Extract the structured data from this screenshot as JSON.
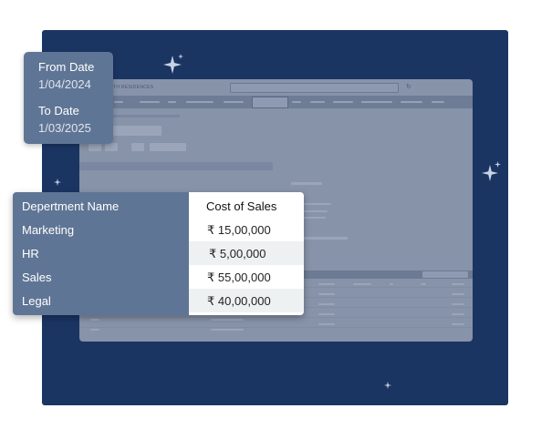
{
  "date_filter": {
    "from_label": "From Date",
    "from_value": "1/04/2024",
    "to_label": "To Date",
    "to_value": "1/03/2025"
  },
  "table": {
    "headers": [
      "Depertment Name",
      "Cost of Sales"
    ],
    "rows": [
      {
        "department": "Marketing",
        "cost": "₹ 15,00,000"
      },
      {
        "department": "HR",
        "cost": "₹ 5,00,000"
      },
      {
        "department": "Sales",
        "cost": "₹ 55,00,000"
      },
      {
        "department": "Legal",
        "cost": "₹ 40,00,000"
      }
    ]
  },
  "background_app": {
    "title": "...NTH RESIDENCES"
  },
  "colors": {
    "navy_panel": "#1b3563",
    "card_slate": "#5f7595",
    "app_window": "#8793a9"
  },
  "icons": [
    "sparkle-icon",
    "refresh-icon"
  ]
}
